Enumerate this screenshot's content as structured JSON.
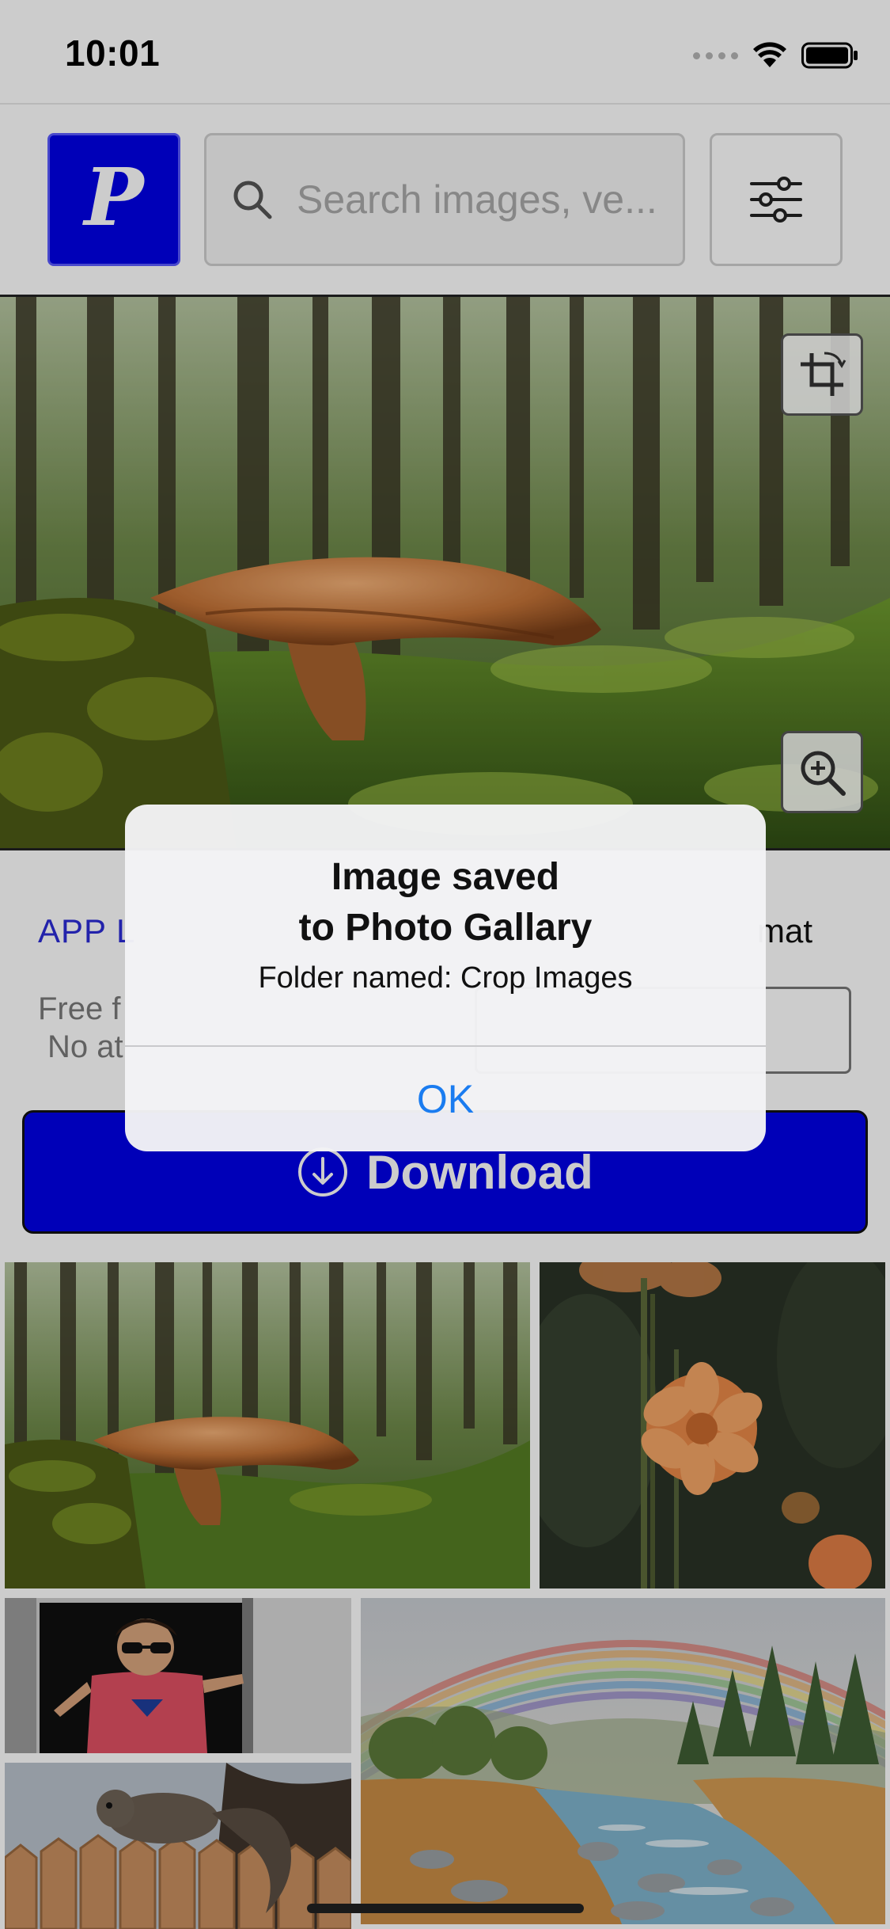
{
  "status_bar": {
    "time": "10:01"
  },
  "header": {
    "logo_letter": "P",
    "search_placeholder": "Search images, ve...",
    "colors": {
      "logo_bg": "#0000e6"
    }
  },
  "hero": {
    "icons": [
      "crop-icon",
      "zoom-in-icon"
    ]
  },
  "info": {
    "license_link": "APP L",
    "license_note_line1": "Free f",
    "license_note_line2": "No at",
    "format_label": "mat",
    "download_label": "Download"
  },
  "alert": {
    "title_line1": "Image saved",
    "title_line2": "to Photo Gallary",
    "message": "Folder named: Crop Images",
    "ok_label": "OK"
  },
  "gallery": {
    "tiles": [
      "forest-mushroom",
      "orange-dahlia",
      "child-in-doorway",
      "watercolor-rainbow-river",
      "squirrel-on-fence"
    ]
  }
}
